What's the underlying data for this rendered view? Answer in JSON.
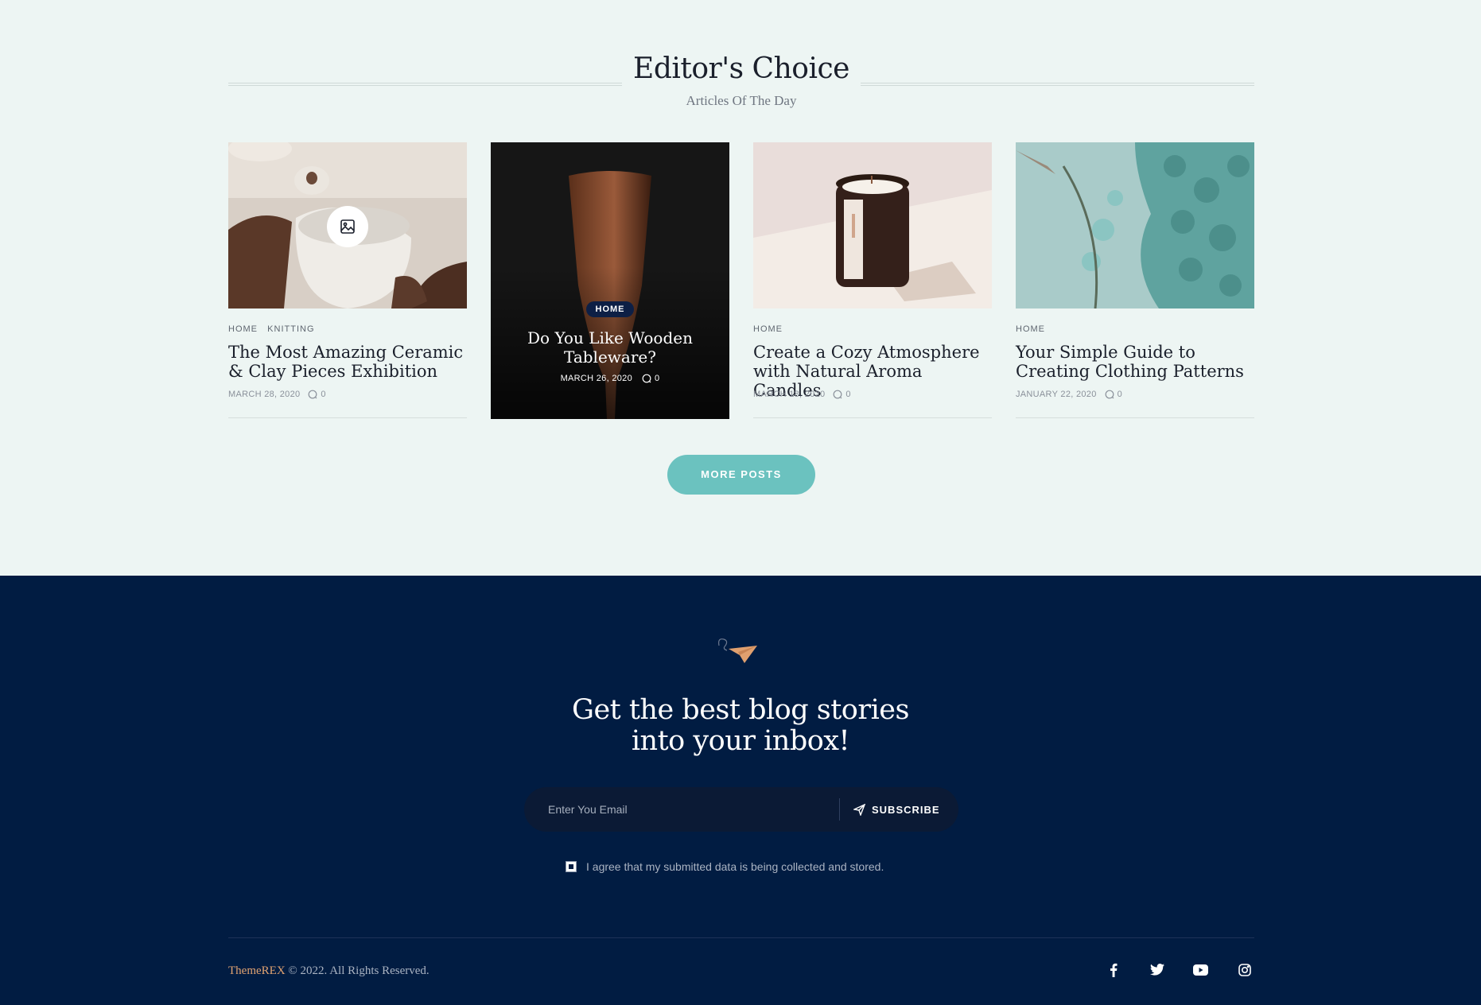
{
  "section": {
    "title": "Editor's Choice",
    "subtitle": "Articles Of The Day"
  },
  "posts": [
    {
      "categories": [
        "HOME",
        "KNITTING"
      ],
      "title": "The Most Amazing Ceramic & Clay Pieces Exhibition",
      "date": "MARCH 28, 2020",
      "comments": "0"
    },
    {
      "category": "HOME",
      "title": "Do You Like Wooden Tableware?",
      "date": "MARCH 26, 2020",
      "comments": "0"
    },
    {
      "category": "HOME",
      "title": "Create a Cozy Atmosphere with Natural Aroma Candles",
      "date": "MARCH 18, 2020",
      "comments": "0"
    },
    {
      "category": "HOME",
      "title": "Your Simple Guide to Creating Clothing Patterns",
      "date": "JANUARY 22, 2020",
      "comments": "0"
    }
  ],
  "more_button": "MORE POSTS",
  "newsletter": {
    "title_line1": "Get the best blog stories",
    "title_line2": "into your inbox!",
    "placeholder": "Enter You Email",
    "subscribe_label": "SUBSCRIBE",
    "agree_text": "I agree that my submitted data is being collected and stored.",
    "agree_checked": true
  },
  "footer": {
    "brand": "ThemeREX",
    "copyright": " © 2022. All Rights Reserved.",
    "socials": [
      "facebook-icon",
      "twitter-icon",
      "youtube-icon",
      "instagram-icon"
    ]
  },
  "colors": {
    "page_bg": "#edf5f3",
    "footer_bg": "#011c42",
    "accent": "#6bc2bf",
    "brand": "#e2a371"
  }
}
